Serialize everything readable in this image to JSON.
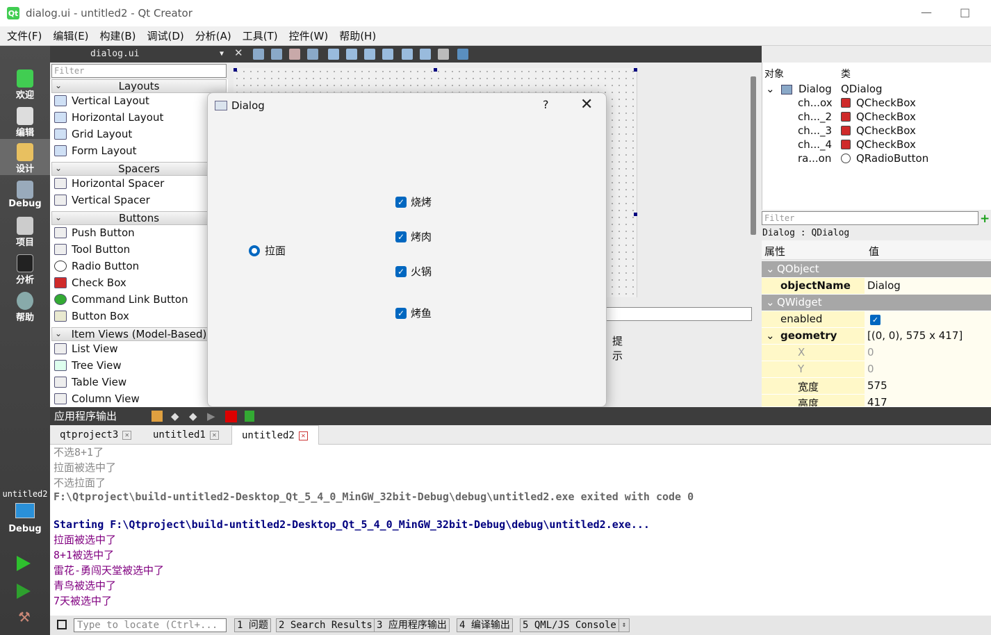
{
  "window": {
    "title": "dialog.ui - untitled2 - Qt Creator",
    "minimize": "—",
    "maximize": "□"
  },
  "menu": [
    "文件(F)",
    "编辑(E)",
    "构建(B)",
    "调试(D)",
    "分析(A)",
    "工具(T)",
    "控件(W)",
    "帮助(H)"
  ],
  "modes": [
    "欢迎",
    "编辑",
    "设计",
    "Debug",
    "项目",
    "分析",
    "帮助"
  ],
  "kit": {
    "project": "untitled2",
    "mode": "Debug"
  },
  "editor": {
    "file_name": "dialog.ui",
    "close": "✕"
  },
  "widget_box": {
    "filter_placeholder": "Filter",
    "categories": [
      "Layouts",
      "Spacers",
      "Buttons",
      "Item Views (Model-Based)"
    ],
    "layouts": [
      "Vertical Layout",
      "Horizontal Layout",
      "Grid Layout",
      "Form Layout"
    ],
    "spacers": [
      "Horizontal Spacer",
      "Vertical Spacer"
    ],
    "buttons": [
      "Push Button",
      "Tool Button",
      "Radio Button",
      "Check Box",
      "Command Link Button",
      "Button Box"
    ],
    "item_views": [
      "List View",
      "Tree View",
      "Table View",
      "Column View"
    ]
  },
  "background_hint": "提示",
  "dialog": {
    "title": "Dialog",
    "help": "?",
    "close": "✕",
    "radio": "拉面",
    "checkboxes": [
      "烧烤",
      "烤肉",
      "火锅",
      "烤鱼"
    ]
  },
  "object_inspector": {
    "col_object": "对象",
    "col_class": "类",
    "rows": [
      {
        "object": "Dialog",
        "class": "QDialog"
      },
      {
        "object": "ch...ox",
        "class": "QCheckBox"
      },
      {
        "object": "ch..._2",
        "class": "QCheckBox"
      },
      {
        "object": "ch..._3",
        "class": "QCheckBox"
      },
      {
        "object": "ch..._4",
        "class": "QCheckBox"
      },
      {
        "object": "ra...on",
        "class": "QRadioButton"
      }
    ]
  },
  "property_editor": {
    "filter_placeholder": "Filter",
    "object_label": "Dialog : QDialog",
    "col_property": "属性",
    "col_value": "值",
    "group_qobject": "QObject",
    "objectName": {
      "name": "objectName",
      "value": "Dialog"
    },
    "group_qwidget": "QWidget",
    "enabled": {
      "name": "enabled"
    },
    "geometry": {
      "name": "geometry",
      "value": "[(0, 0), 575 x 417]"
    },
    "x": {
      "name": "X",
      "value": "0"
    },
    "y": {
      "name": "Y",
      "value": "0"
    },
    "width": {
      "name": "宽度",
      "value": "575"
    },
    "height": {
      "name": "高度",
      "value": "417"
    }
  },
  "output_pane": {
    "title": "应用程序输出",
    "tabs": [
      "qtproject3",
      "untitled1",
      "untitled2"
    ],
    "lines": [
      {
        "text": "不选8+1了",
        "style": "gray"
      },
      {
        "text": "拉面被选中了",
        "style": "gray"
      },
      {
        "text": "不选拉面了",
        "style": "gray"
      },
      {
        "text": "F:\\Qtproject\\build-untitled2-Desktop_Qt_5_4_0_MinGW_32bit-Debug\\debug\\untitled2.exe exited with code 0",
        "style": "boldgray"
      },
      {
        "text": "Starting F:\\Qtproject\\build-untitled2-Desktop_Qt_5_4_0_MinGW_32bit-Debug\\debug\\untitled2.exe...",
        "style": "boldblue"
      },
      {
        "text": "拉面被选中了",
        "style": "purple"
      },
      {
        "text": "8+1被选中了",
        "style": "purple"
      },
      {
        "text": "雷花-勇闯天堂被选中了",
        "style": "purple"
      },
      {
        "text": "青鸟被选中了",
        "style": "purple"
      },
      {
        "text": "7天被选中了",
        "style": "purple"
      }
    ]
  },
  "statusbar": {
    "locator_placeholder": "Type to locate (Ctrl+...",
    "panes": [
      "1 问题",
      "2 Search Results",
      "3 应用程序输出",
      "4 编译输出",
      "5 QML/JS Console"
    ]
  },
  "colors": {
    "accent": "#0067c0",
    "qt_green": "#41cd52",
    "output_purple": "#800080",
    "output_blue": "#000080"
  }
}
